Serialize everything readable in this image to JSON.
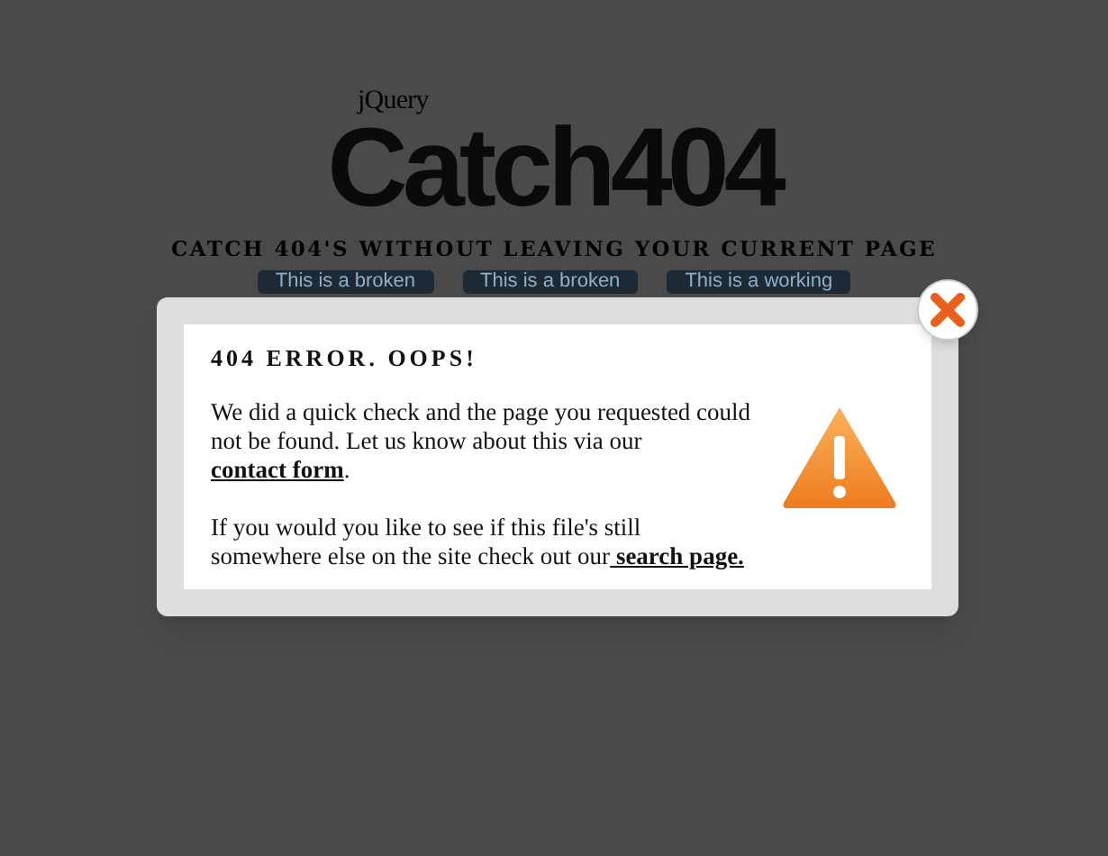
{
  "header": {
    "kicker": "jQuery",
    "title": "Catch404",
    "tagline": "CATCH 404'S WITHOUT LEAVING YOUR CURRENT PAGE"
  },
  "demo_buttons": [
    "This is a broken",
    "This is a broken",
    "This is a working"
  ],
  "modal": {
    "heading": "404 ERROR. OOPS!",
    "paragraphs": [
      {
        "before": "We did a quick check and the page you requested could not be found. Let us know about this via our ",
        "link": "contact form",
        "after": "."
      },
      {
        "before": "If you would you like to see if this file's still somewhere else on the site check out our",
        "link": " search page."
      }
    ]
  }
}
